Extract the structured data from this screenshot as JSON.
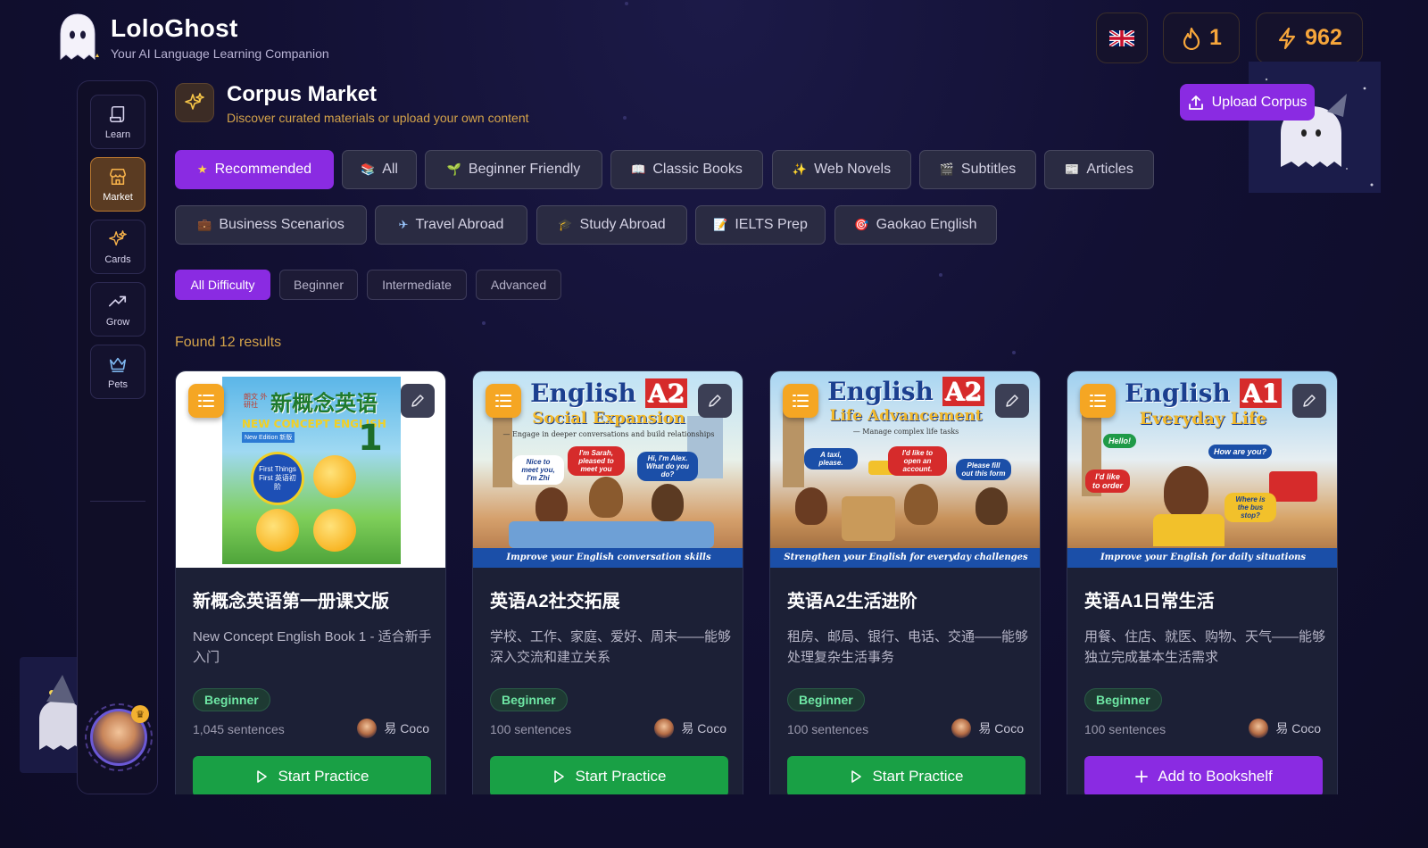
{
  "brand": {
    "title": "LoloGhost",
    "subtitle": "Your AI Language Learning Companion"
  },
  "topbar": {
    "streak": "1",
    "xp": "962",
    "language_flag": "uk-flag-icon"
  },
  "sidebar": {
    "items": [
      {
        "label": "Learn",
        "icon": "scroll-icon",
        "active": false
      },
      {
        "label": "Market",
        "icon": "store-icon",
        "active": true
      },
      {
        "label": "Cards",
        "icon": "sparkles-icon",
        "active": false
      },
      {
        "label": "Grow",
        "icon": "trend-icon",
        "active": false
      },
      {
        "label": "Pets",
        "icon": "crown-icon",
        "active": false
      }
    ]
  },
  "page": {
    "title": "Corpus Market",
    "subtitle": "Discover curated materials or upload your own content",
    "upload_label": "Upload Corpus",
    "results": "Found 12 results"
  },
  "categories": [
    {
      "label": "Recommended",
      "icon": "★",
      "active": true
    },
    {
      "label": "All",
      "icon": "📚",
      "active": false
    },
    {
      "label": "Beginner Friendly",
      "icon": "🌱",
      "active": false
    },
    {
      "label": "Classic Books",
      "icon": "📖",
      "active": false
    },
    {
      "label": "Web Novels",
      "icon": "✨",
      "active": false
    },
    {
      "label": "Subtitles",
      "icon": "🎬",
      "active": false
    },
    {
      "label": "Articles",
      "icon": "📰",
      "active": false
    },
    {
      "label": "Business Scenarios",
      "icon": "💼",
      "active": false
    },
    {
      "label": "Travel Abroad",
      "icon": "✈",
      "active": false
    },
    {
      "label": "Study Abroad",
      "icon": "🎓",
      "active": false
    },
    {
      "label": "IELTS Prep",
      "icon": "📝",
      "active": false
    },
    {
      "label": "Gaokao English",
      "icon": "🎯",
      "active": false
    }
  ],
  "difficulty": [
    {
      "label": "All Difficulty",
      "active": true
    },
    {
      "label": "Beginner",
      "active": false
    },
    {
      "label": "Intermediate",
      "active": false
    },
    {
      "label": "Advanced",
      "active": false
    }
  ],
  "cards": [
    {
      "title": "新概念英语第一册课文版",
      "desc": "New Concept English Book 1 - 适合新手入门",
      "level": "Beginner",
      "sentences": "1,045 sentences",
      "author": "易 Coco",
      "action": "Start Practice",
      "action_style": "green",
      "cover": {
        "style": "book",
        "line1": "朗文 外研社",
        "line2": "新概念英语",
        "line3": "NEW CONCEPT ENGLISH",
        "line4": "New Edition 新版",
        "badge": "First Things First 英语初阶",
        "num": "1"
      }
    },
    {
      "title": "英语A2社交拓展",
      "desc": "学校、工作、家庭、爱好、周末——能够深入交流和建立关系",
      "level": "Beginner",
      "sentences": "100 sentences",
      "author": "易 Coco",
      "action": "Start Practice",
      "action_style": "green",
      "cover": {
        "style": "scene",
        "word": "English",
        "lvl": "A2",
        "sub": "Social Expansion",
        "tag": "— Engage in deeper conversations and build relationships",
        "bubbles": [
          "Nice to meet you, I'm Zhi",
          "I'm Sarah, pleased to meet you",
          "Hi, I'm Alex. What do you do?"
        ],
        "footer": "Improve your English conversation skills"
      }
    },
    {
      "title": "英语A2生活进阶",
      "desc": "租房、邮局、银行、电话、交通——能够处理复杂生活事务",
      "level": "Beginner",
      "sentences": "100 sentences",
      "author": "易 Coco",
      "action": "Start Practice",
      "action_style": "green",
      "cover": {
        "style": "scene",
        "word": "English",
        "lvl": "A2",
        "sub": "Life Advancement",
        "tag": "— Manage complex life tasks",
        "bubbles": [
          "A taxi, please.",
          "I'd like to open an account.",
          "Please fill out this form"
        ],
        "footer": "Strengthen your English for everyday challenges"
      }
    },
    {
      "title": "英语A1日常生活",
      "desc": "用餐、住店、就医、购物、天气——能够独立完成基本生活需求",
      "level": "Beginner",
      "sentences": "100 sentences",
      "author": "易 Coco",
      "action": "Add to Bookshelf",
      "action_style": "purple",
      "cover": {
        "style": "scene",
        "word": "English",
        "lvl": "A1",
        "sub": "Everyday Life",
        "tag": "",
        "bubbles": [
          "Hello!",
          "How are you?",
          "I'd like to order",
          "Where is the bus stop?"
        ],
        "footer": "Improve your English for daily situations"
      }
    }
  ]
}
